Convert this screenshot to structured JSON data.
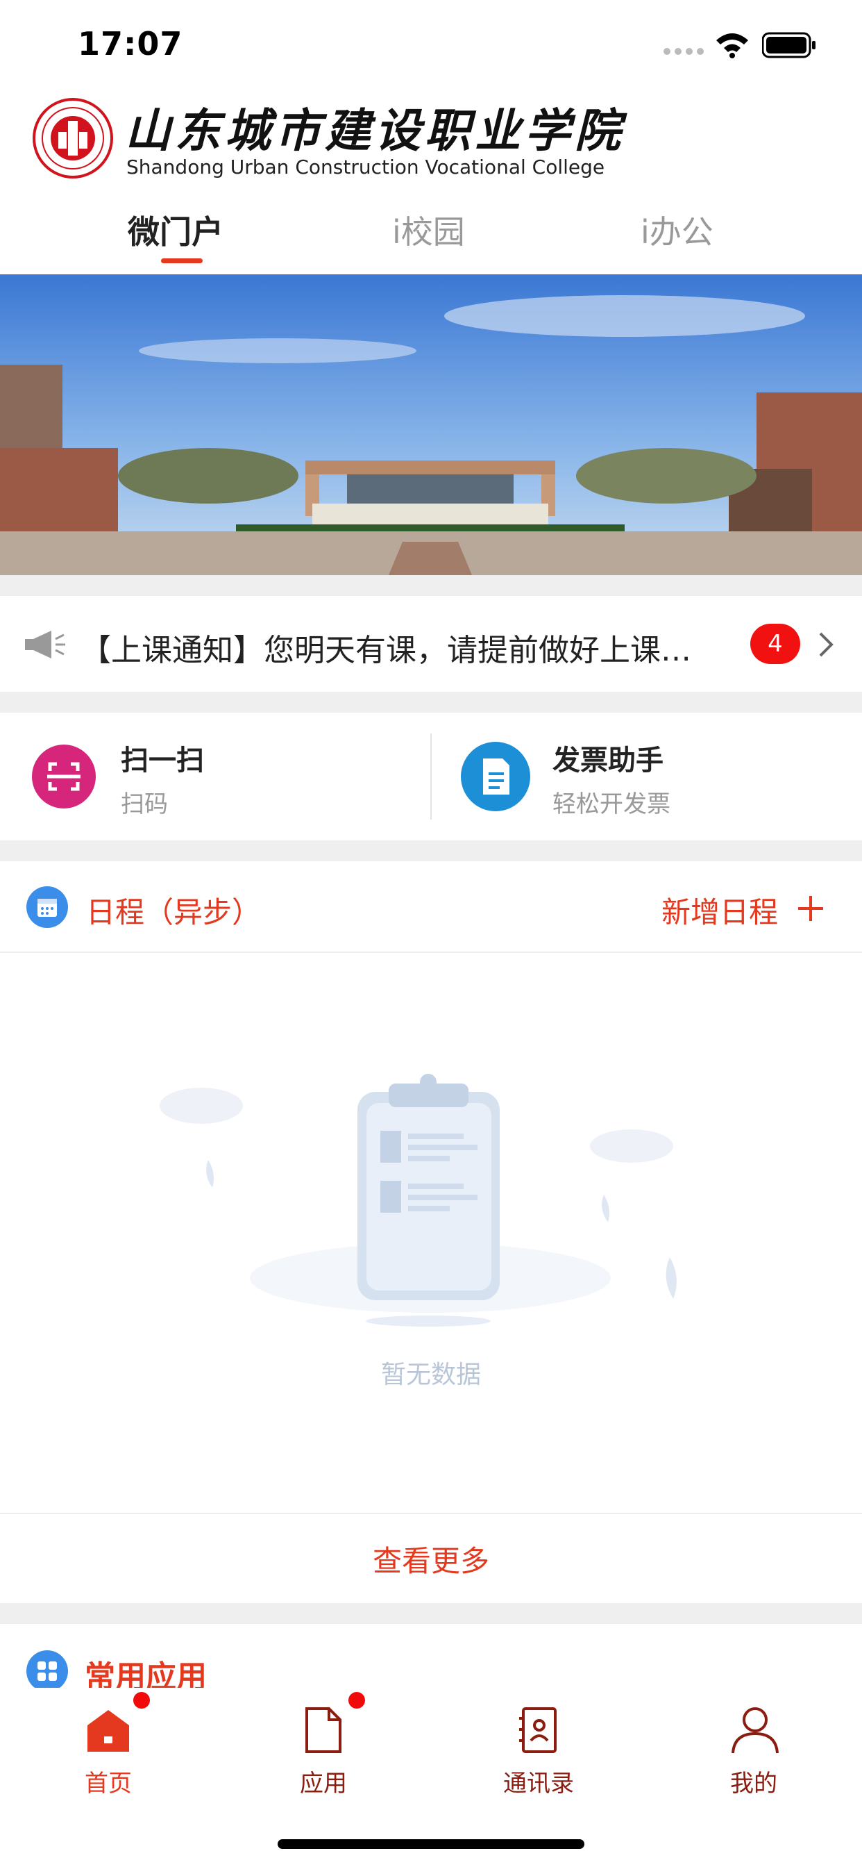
{
  "status_bar": {
    "time": "17:07"
  },
  "header": {
    "logo_cn": "山东城市建设职业学院",
    "logo_en": "Shandong Urban Construction Vocational College",
    "tabs": [
      {
        "label": "微门户",
        "active": true
      },
      {
        "label": "i校园",
        "active": false
      },
      {
        "label": "i办公",
        "active": false
      }
    ]
  },
  "notice": {
    "text": "【上课通知】您明天有课，请提前做好上课准备",
    "badge_count": "4"
  },
  "quick_actions": [
    {
      "title": "扫一扫",
      "subtitle": "扫码",
      "icon": "scan-icon",
      "color": "#d5267c"
    },
    {
      "title": "发票助手",
      "subtitle": "轻松开发票",
      "icon": "document-icon",
      "color": "#1d8fd6"
    }
  ],
  "schedule": {
    "title": "日程（异步）",
    "add_label": "新增日程",
    "empty_text": "暂无数据",
    "more_label": "查看更多"
  },
  "common_apps": {
    "title": "常用应用"
  },
  "tab_bar": {
    "items": [
      {
        "label": "首页",
        "icon": "home-icon",
        "active": true,
        "dot": true
      },
      {
        "label": "应用",
        "icon": "file-icon",
        "active": false,
        "dot": true
      },
      {
        "label": "通讯录",
        "icon": "contacts-icon",
        "active": false,
        "dot": false
      },
      {
        "label": "我的",
        "icon": "person-icon",
        "active": false,
        "dot": false
      }
    ]
  },
  "colors": {
    "accent": "#e5391f",
    "badge": "#f21111",
    "tab_inactive": "#8a1c10"
  }
}
